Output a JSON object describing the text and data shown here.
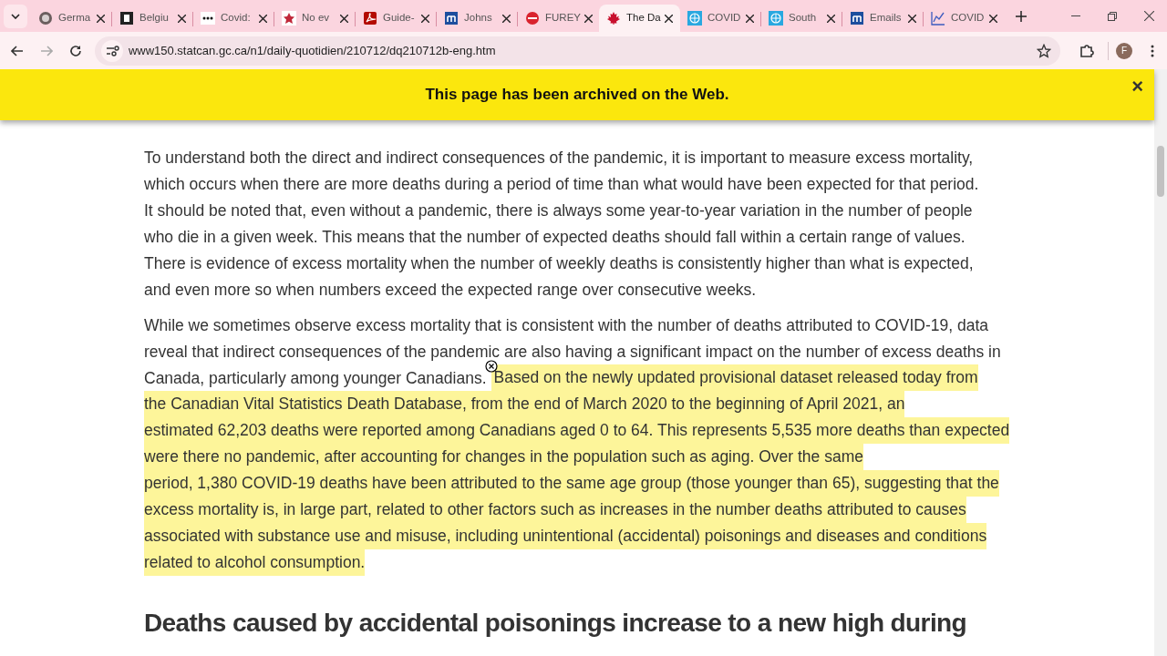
{
  "tabs": [
    {
      "title": "Germa",
      "kind": "grey-circle",
      "selected": false
    },
    {
      "title": "Belgiu",
      "kind": "black-square",
      "selected": false
    },
    {
      "title": "Covid:",
      "kind": "dots",
      "selected": false
    },
    {
      "title": "No ev",
      "kind": "red-star",
      "selected": false
    },
    {
      "title": "Guide-",
      "kind": "pdf",
      "selected": false
    },
    {
      "title": "Johns",
      "kind": "blue-square",
      "selected": false
    },
    {
      "title": "FUREY",
      "kind": "red-circle",
      "selected": false
    },
    {
      "title": "The Da",
      "kind": "maple-leaf",
      "selected": true
    },
    {
      "title": "COVID",
      "kind": "globe",
      "selected": false
    },
    {
      "title": "South",
      "kind": "globe",
      "selected": false
    },
    {
      "title": "Emails",
      "kind": "blue-square",
      "selected": false
    },
    {
      "title": "COVID",
      "kind": "line-chart",
      "selected": false
    }
  ],
  "address_bar": {
    "url": "www150.statcan.gc.ca/n1/daily-quotidien/210712/dq210712b-eng.htm"
  },
  "profile": {
    "initial": "F"
  },
  "banner": {
    "text": "This page has been archived on the Web.",
    "close": "×"
  },
  "paragraphs": [
    {
      "lines": [
        {
          "segments": [
            {
              "text": "To understand both the direct and indirect consequences of the pandemic, it is important to measure excess mortality,",
              "highlighted": false
            }
          ]
        },
        {
          "segments": [
            {
              "text": "which occurs when there are more deaths during a period of time than what would have been expected for that period.",
              "highlighted": false
            }
          ]
        },
        {
          "segments": [
            {
              "text": "It should be noted that, even without a pandemic, there is always some year-to-year variation in the number of people",
              "highlighted": false
            }
          ]
        },
        {
          "segments": [
            {
              "text": "who die in a given week. This means that the number of expected deaths should fall within a certain range of values.",
              "highlighted": false
            }
          ]
        },
        {
          "segments": [
            {
              "text": "There is evidence of excess mortality when the number of weekly deaths is consistently higher than what is expected,",
              "highlighted": false
            }
          ]
        },
        {
          "segments": [
            {
              "text": "and even more so when numbers exceed the expected range over consecutive weeks.",
              "highlighted": false
            }
          ]
        }
      ]
    },
    {
      "lines": [
        {
          "segments": [
            {
              "text": "While we sometimes observe excess mortality that is consistent with the number of deaths attributed to COVID-19, data",
              "highlighted": false
            }
          ]
        },
        {
          "segments": [
            {
              "text": "reveal that indirect consequences of the pandemic are also having a significant impact on the number of excess deaths in",
              "highlighted": false
            }
          ]
        },
        {
          "segments": [
            {
              "text": "Canada, particularly among younger Canadians.",
              "highlighted": false
            },
            {
              "text": "Based on the newly updated provisional dataset released today from",
              "highlighted": true
            }
          ]
        },
        {
          "segments": [
            {
              "text": "the Canadian Vital Statistics Death Database, from the end of March 2020 to the beginning of April 2021, an",
              "highlighted": true
            }
          ]
        },
        {
          "segments": [
            {
              "text": "estimated 62,203 deaths were reported among Canadians aged 0 to 64. This represents 5,535 more deaths than expected",
              "highlighted": true
            }
          ]
        },
        {
          "segments": [
            {
              "text": "were there no pandemic, after accounting for changes in the population such as aging. Over the same",
              "highlighted": true
            }
          ]
        },
        {
          "segments": [
            {
              "text": "period, 1,380 COVID-19 deaths have been attributed to the same age group (those younger than 65), suggesting that the",
              "highlighted": true
            }
          ]
        },
        {
          "segments": [
            {
              "text": "excess mortality is, in large part, related to other factors such as increases in the number deaths attributed to causes",
              "highlighted": true
            }
          ]
        },
        {
          "segments": [
            {
              "text": "associated with substance use and misuse, including unintentional (accidental) poisonings and diseases and conditions",
              "highlighted": true
            }
          ]
        },
        {
          "segments": [
            {
              "text": "related to alcohol consumption.",
              "highlighted": true
            }
          ]
        }
      ]
    }
  ],
  "heading": "Deaths caused by accidental poisonings increase to a new high during"
}
